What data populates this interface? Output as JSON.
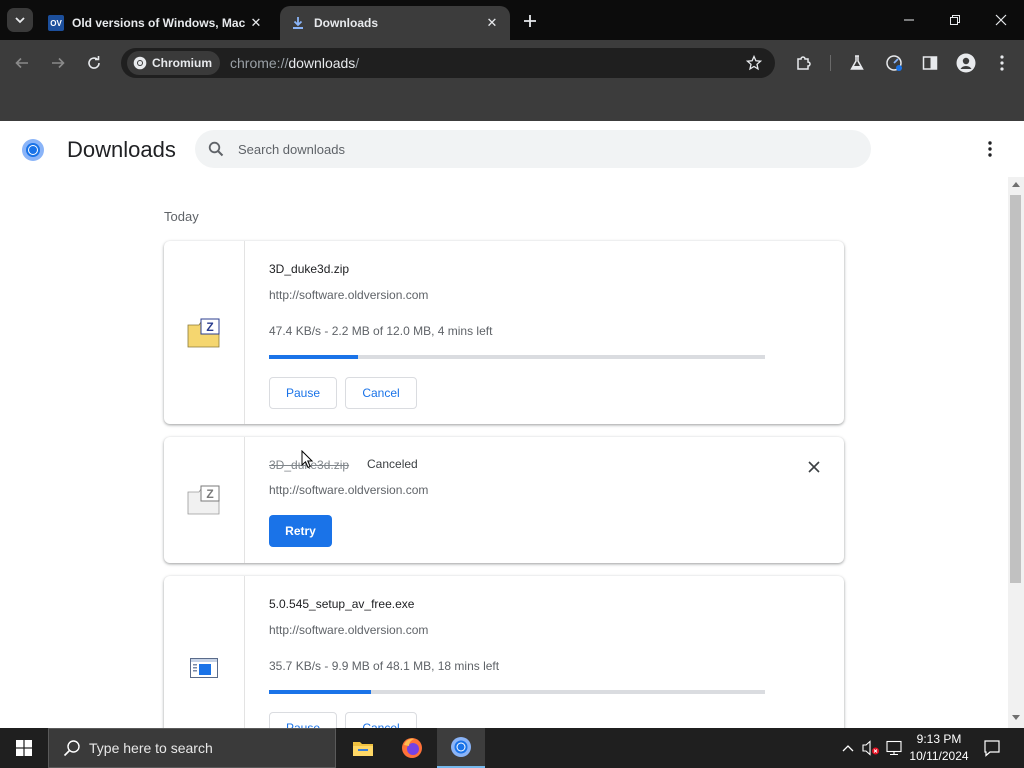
{
  "browser": {
    "tabs": [
      {
        "title": "Old versions of Windows, Mac",
        "favicon": "OV",
        "active": false
      },
      {
        "title": "Downloads",
        "active": true
      }
    ],
    "site_chip": "Chromium",
    "url_scheme": "chrome://",
    "url_host": "downloads",
    "url_path": "/"
  },
  "page": {
    "title": "Downloads",
    "search_placeholder": "Search downloads",
    "date_header": "Today"
  },
  "downloads": [
    {
      "file_name": "3D_duke3d.zip",
      "url": "http://software.oldversion.com",
      "progress_text": "47.4 KB/s - 2.2 MB of 12.0 MB, 4 mins left",
      "progress_fraction": 0.18,
      "pause_label": "Pause",
      "cancel_label": "Cancel",
      "icon": "zip-file-icon"
    },
    {
      "file_name": "3D_duke3d.zip",
      "status": "Canceled",
      "url": "http://software.oldversion.com",
      "retry_label": "Retry",
      "icon": "zip-file-icon"
    },
    {
      "file_name": "5.0.545_setup_av_free.exe",
      "url": "http://software.oldversion.com",
      "progress_text": "35.7 KB/s - 9.9 MB of 48.1 MB, 18 mins left",
      "progress_fraction": 0.206,
      "pause_label": "Pause",
      "cancel_label": "Cancel",
      "icon": "exe-file-icon"
    }
  ],
  "taskbar": {
    "search_placeholder": "Type here to search",
    "time": "9:13 PM",
    "date": "10/11/2024"
  },
  "colors": {
    "accent": "#1a73e8",
    "tabstrip": "#0c0c0c",
    "toolbar": "#3c3c3c",
    "taskbar": "#1f1f1f"
  }
}
